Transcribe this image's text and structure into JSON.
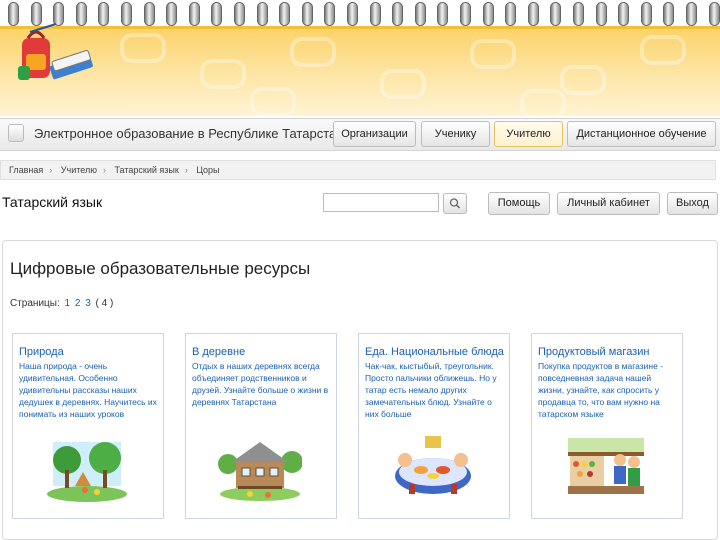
{
  "app": {
    "site_title": "Электронное образование в Республике Татарстан"
  },
  "nav": {
    "items": [
      {
        "label": "Организации",
        "active": false
      },
      {
        "label": "Ученику",
        "active": false
      },
      {
        "label": "Учителю",
        "active": true
      },
      {
        "label": "Дистанционное обучение",
        "active": false
      }
    ]
  },
  "breadcrumb": [
    "Главная",
    "Учителю",
    "Татарский язык",
    "Цоры"
  ],
  "section": {
    "title": "Татарский язык",
    "search_value": "",
    "help_label": "Помощь",
    "cabinet_label": "Личный кабинет",
    "exit_label": "Выход"
  },
  "content": {
    "title": "Цифровые образовательные ресурсы",
    "pages_label": "Страницы:",
    "pages": [
      "1",
      "2",
      "3"
    ],
    "current_page": "( 4 )",
    "cards": [
      {
        "title": "Природа",
        "desc": "Наша природа - очень удивительная. Особенно удивительны рассказы наших дедушек в деревнях. Научитесь их понимать из наших уроков",
        "image": "nature-illustration"
      },
      {
        "title": "В деревне",
        "desc": "Отдых в наших деревнях всегда объединяет родственников и друзей. Узнайте больше о жизни в деревнях Татарстана",
        "image": "village-house-illustration"
      },
      {
        "title": "Еда. Национальные блюда",
        "desc": "Чак-чак, кыстыбый, треугольник. Просто пальчики оближешь. Но у татар есть немало других замечательных блюд. Узнайте о них больше",
        "image": "food-table-illustration"
      },
      {
        "title": "Продуктовый магазин",
        "desc": "Покупка продуктов в магазине - повседневная задача нашей жизни, узнайте, как спросить у продавца то, что вам нужно на татарском языке",
        "image": "grocery-store-illustration"
      }
    ]
  },
  "colors": {
    "banner": "#fbd36a",
    "link": "#1a5fb4",
    "active_tab": "#fff1cc"
  }
}
